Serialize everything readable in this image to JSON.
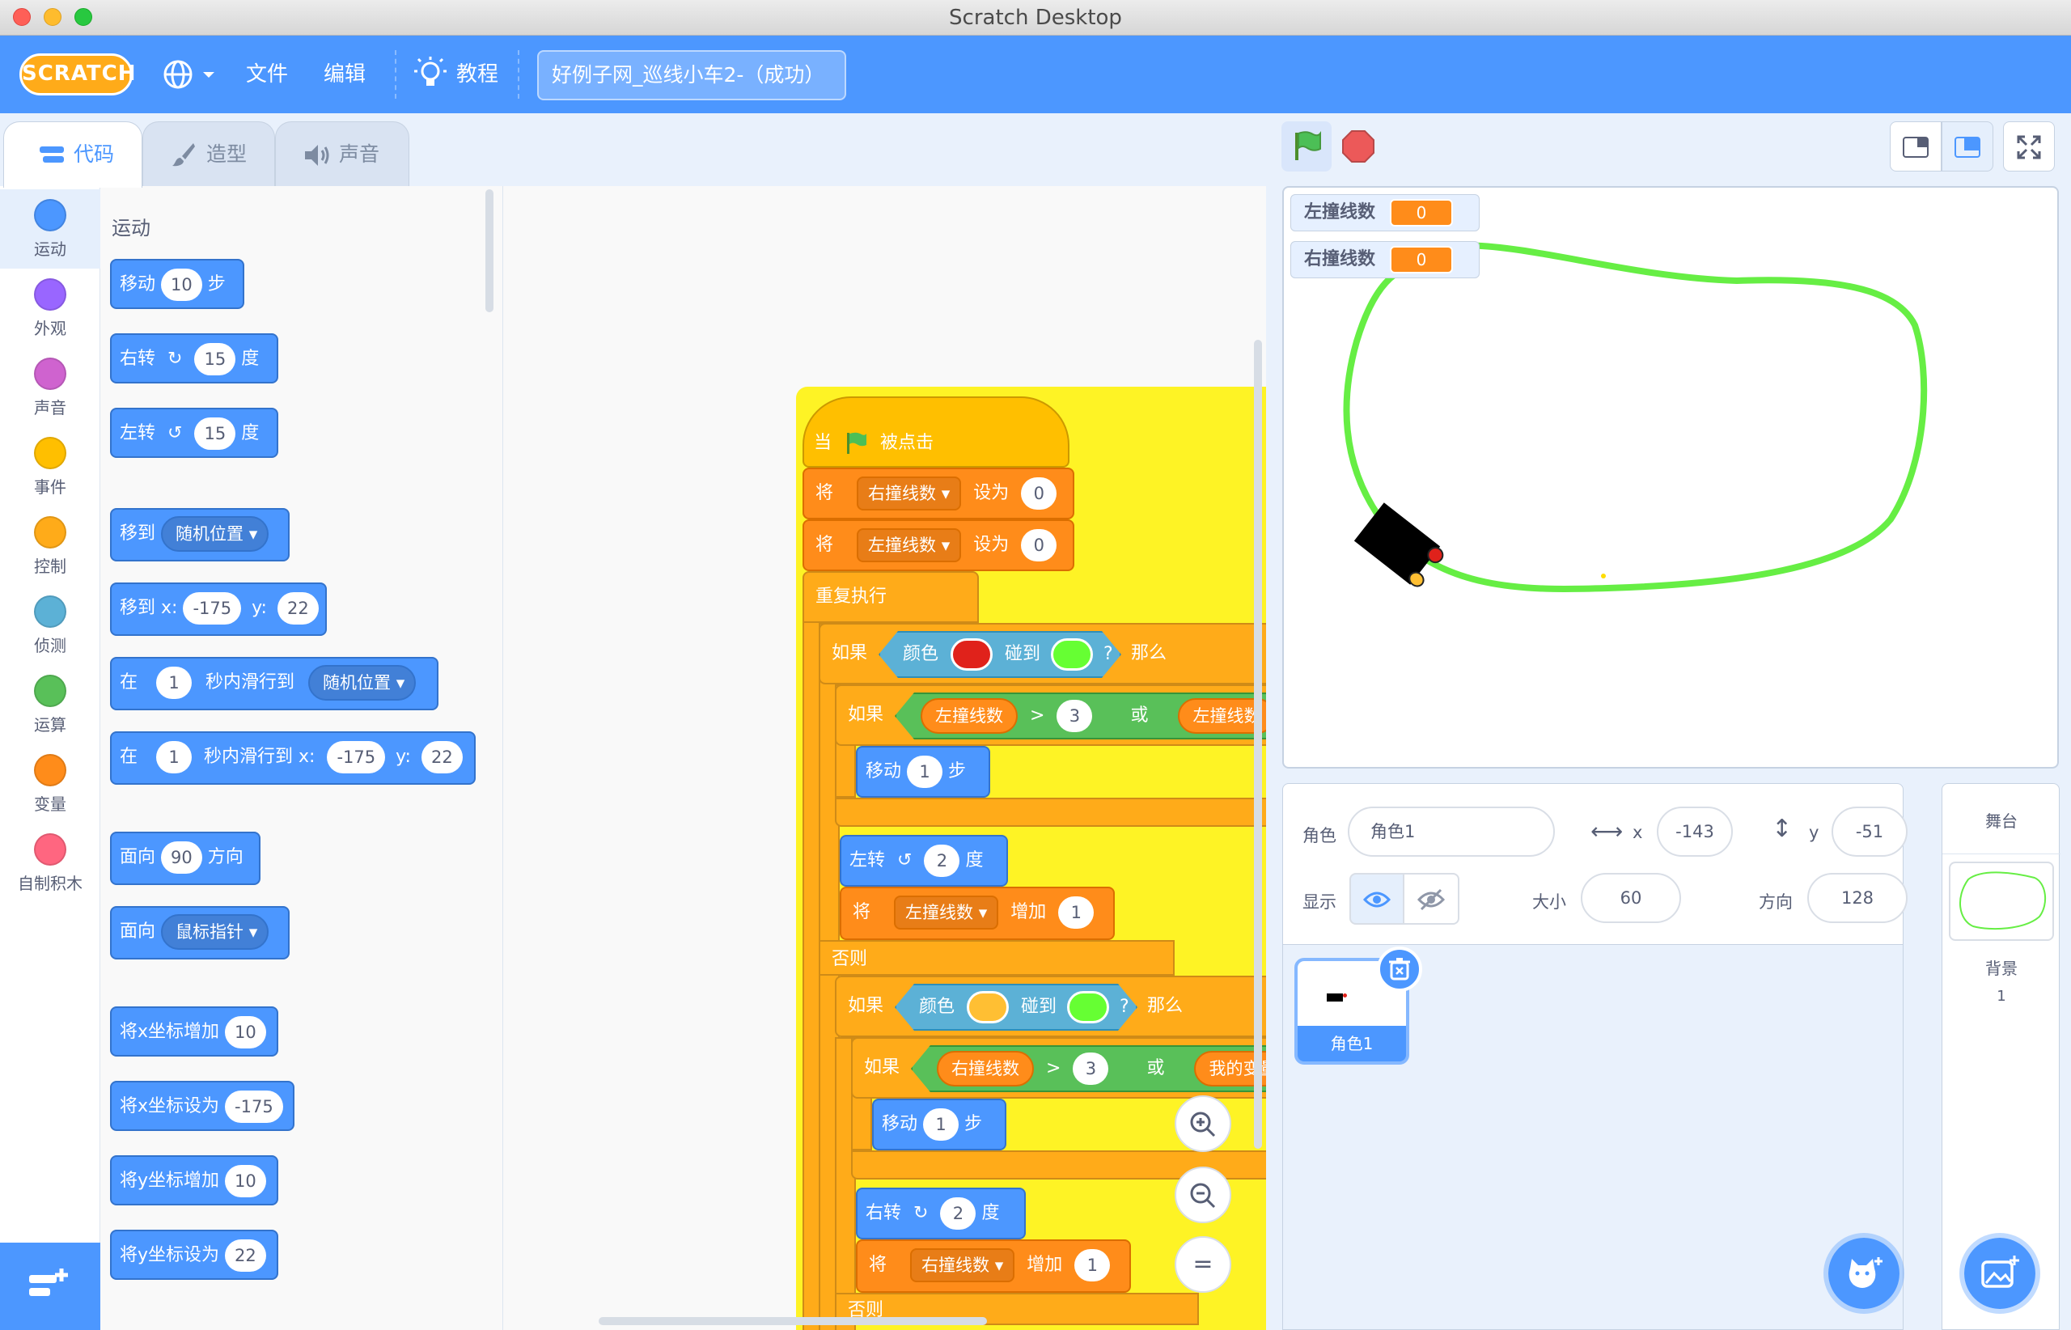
{
  "window": {
    "title": "Scratch Desktop"
  },
  "menubar": {
    "logo": "SCRATCH",
    "file": "文件",
    "edit": "编辑",
    "tutorials": "教程",
    "project_title": "好例子网_巡线小车2-（成功）"
  },
  "tabs": {
    "code": "代码",
    "costumes": "造型",
    "sounds": "声音"
  },
  "categories": [
    {
      "label": "运动",
      "color": "#4c97ff"
    },
    {
      "label": "外观",
      "color": "#9966ff"
    },
    {
      "label": "声音",
      "color": "#cf63cf"
    },
    {
      "label": "事件",
      "color": "#ffbf00"
    },
    {
      "label": "控制",
      "color": "#ffab19"
    },
    {
      "label": "侦测",
      "color": "#5cb1d6"
    },
    {
      "label": "运算",
      "color": "#59c059"
    },
    {
      "label": "变量",
      "color": "#ff8c1a"
    },
    {
      "label": "自制积木",
      "color": "#ff6680"
    }
  ],
  "palette": {
    "heading": "运动",
    "move": {
      "a": "移动",
      "v": "10",
      "b": "步"
    },
    "turn_right": {
      "a": "右转",
      "v": "15",
      "b": "度"
    },
    "turn_left": {
      "a": "左转",
      "v": "15",
      "b": "度"
    },
    "goto": {
      "a": "移到",
      "dd": "随机位置"
    },
    "goto_xy": {
      "a": "移到 x:",
      "x": "-175",
      "yl": "y:",
      "y": "22"
    },
    "glide": {
      "a": "在",
      "v": "1",
      "b": "秒内滑行到",
      "dd": "随机位置"
    },
    "glide_xy": {
      "a": "在",
      "v": "1",
      "b": "秒内滑行到 x:",
      "x": "-175",
      "yl": "y:",
      "y": "22"
    },
    "point_dir": {
      "a": "面向",
      "v": "90",
      "b": "方向"
    },
    "point_towards": {
      "a": "面向",
      "dd": "鼠标指针"
    },
    "change_x": {
      "a": "将x坐标增加",
      "v": "10"
    },
    "set_x": {
      "a": "将x坐标设为",
      "v": "-175"
    },
    "change_y": {
      "a": "将y坐标增加",
      "v": "10"
    },
    "set_y": {
      "a": "将y坐标设为",
      "v": "22"
    }
  },
  "script": {
    "hat": {
      "a": "当",
      "b": "被点击"
    },
    "set_right": {
      "a": "将",
      "var": "右撞线数",
      "b": "设为",
      "v": "0"
    },
    "set_left": {
      "a": "将",
      "var": "左撞线数",
      "b": "设为",
      "v": "0"
    },
    "forever": "重复执行",
    "if1": {
      "a": "如果",
      "sense": "颜色",
      "touch": "碰到",
      "q": "?",
      "then": "那么",
      "color1": "#e0221b",
      "color2": "#66ff33"
    },
    "if1_inner": {
      "a": "如果",
      "var": "左撞线数",
      "op": ">",
      "v": "3",
      "or": "或",
      "var2": "左撞线数"
    },
    "move1": {
      "a": "移动",
      "v": "1",
      "b": "步"
    },
    "turn_left": {
      "a": "左转",
      "v": "2",
      "b": "度"
    },
    "change_left": {
      "a": "将",
      "var": "左撞线数",
      "b": "增加",
      "v": "1"
    },
    "else1": "否则",
    "if2": {
      "a": "如果",
      "sense": "颜色",
      "touch": "碰到",
      "q": "?",
      "then": "那么",
      "color1": "#ffbf33",
      "color2": "#66ff33"
    },
    "if2_inner": {
      "a": "如果",
      "var": "右撞线数",
      "op": ">",
      "v": "3",
      "or": "或",
      "var2": "我的变量"
    },
    "move2": {
      "a": "移动",
      "v": "1",
      "b": "步"
    },
    "turn_right": {
      "a": "右转",
      "v": "2",
      "b": "度"
    },
    "change_right": {
      "a": "将",
      "var": "右撞线数",
      "b": "增加",
      "v": "1"
    },
    "else2": "否则"
  },
  "monitors": [
    {
      "label": "左撞线数",
      "value": "0"
    },
    {
      "label": "右撞线数",
      "value": "0"
    }
  ],
  "sprite_info": {
    "sprite_label": "角色",
    "sprite_name": "角色1",
    "x_label": "x",
    "x": "-143",
    "y_label": "y",
    "y": "-51",
    "show_label": "显示",
    "size_label": "大小",
    "size": "60",
    "dir_label": "方向",
    "direction": "128"
  },
  "sprites": [
    {
      "name": "角色1"
    }
  ],
  "stage_panel": {
    "title": "舞台",
    "backdrop_label": "背景",
    "backdrop_count": "1"
  },
  "zoom": {
    "reset": "="
  }
}
